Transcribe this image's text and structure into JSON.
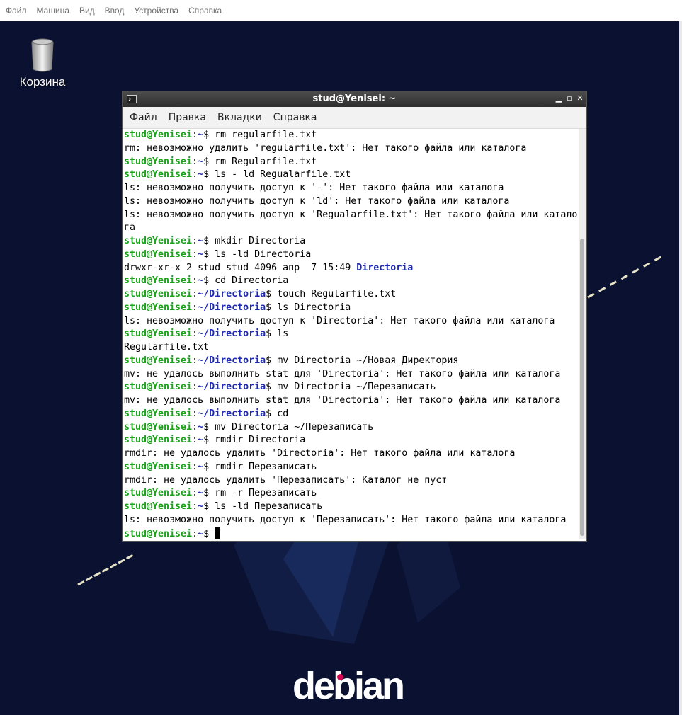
{
  "vm_menu": [
    "Файл",
    "Машина",
    "Вид",
    "Ввод",
    "Устройства",
    "Справка"
  ],
  "desktop": {
    "trash_label": "Корзина",
    "logo_text": "debian",
    "colors": {
      "background": "#0a1131",
      "logo_dot": "#d70751"
    }
  },
  "terminal": {
    "title": "stud@Yenisei: ~",
    "menu": [
      "Файл",
      "Правка",
      "Вкладки",
      "Справка"
    ],
    "colors": {
      "user": "#1aa31a",
      "path": "#1e2ab4"
    },
    "lines": [
      {
        "type": "cmd",
        "user": "stud@Yenisei",
        "path": "~",
        "cmd": " rm regularfile.txt"
      },
      {
        "type": "out",
        "text": "rm: невозможно удалить 'regularfile.txt': Нет такого файла или каталога"
      },
      {
        "type": "cmd",
        "user": "stud@Yenisei",
        "path": "~",
        "cmd": " rm Regularfile.txt"
      },
      {
        "type": "cmd",
        "user": "stud@Yenisei",
        "path": "~",
        "cmd": " ls - ld Regualarfile.txt"
      },
      {
        "type": "out",
        "text": "ls: невозможно получить доступ к '-': Нет такого файла или каталога"
      },
      {
        "type": "out",
        "text": "ls: невозможно получить доступ к 'ld': Нет такого файла или каталога"
      },
      {
        "type": "out",
        "text": "ls: невозможно получить доступ к 'Regualarfile.txt': Нет такого файла или катало"
      },
      {
        "type": "out",
        "text": "га"
      },
      {
        "type": "cmd",
        "user": "stud@Yenisei",
        "path": "~",
        "cmd": " mkdir Directoria"
      },
      {
        "type": "cmd",
        "user": "stud@Yenisei",
        "path": "~",
        "cmd": " ls -ld Directoria"
      },
      {
        "type": "dir",
        "text": "drwxr-xr-x 2 stud stud 4096 апр  7 15:49 ",
        "dir": "Directoria"
      },
      {
        "type": "cmd",
        "user": "stud@Yenisei",
        "path": "~",
        "cmd": " cd Directoria"
      },
      {
        "type": "cmd",
        "user": "stud@Yenisei",
        "path": "~/Directoria",
        "cmd": " touch Regularfile.txt"
      },
      {
        "type": "cmd",
        "user": "stud@Yenisei",
        "path": "~/Directoria",
        "cmd": " ls Directoria"
      },
      {
        "type": "out",
        "text": "ls: невозможно получить доступ к 'Directoria': Нет такого файла или каталога"
      },
      {
        "type": "cmd",
        "user": "stud@Yenisei",
        "path": "~/Directoria",
        "cmd": " ls"
      },
      {
        "type": "out",
        "text": "Regularfile.txt"
      },
      {
        "type": "cmd",
        "user": "stud@Yenisei",
        "path": "~/Directoria",
        "cmd": " mv Directoria ~/Новая_Директория"
      },
      {
        "type": "out",
        "text": "mv: не удалось выполнить stat для 'Directoria': Нет такого файла или каталога"
      },
      {
        "type": "cmd",
        "user": "stud@Yenisei",
        "path": "~/Directoria",
        "cmd": " mv Directoria ~/Перезаписать"
      },
      {
        "type": "out",
        "text": "mv: не удалось выполнить stat для 'Directoria': Нет такого файла или каталога"
      },
      {
        "type": "cmd",
        "user": "stud@Yenisei",
        "path": "~/Directoria",
        "cmd": " cd"
      },
      {
        "type": "cmd",
        "user": "stud@Yenisei",
        "path": "~",
        "cmd": " mv Directoria ~/Перезаписать"
      },
      {
        "type": "cmd",
        "user": "stud@Yenisei",
        "path": "~",
        "cmd": " rmdir Directoria"
      },
      {
        "type": "out",
        "text": "rmdir: не удалось удалить 'Directoria': Нет такого файла или каталога"
      },
      {
        "type": "cmd",
        "user": "stud@Yenisei",
        "path": "~",
        "cmd": " rmdir Перезаписать"
      },
      {
        "type": "out",
        "text": "rmdir: не удалось удалить 'Перезаписать': Каталог не пуст"
      },
      {
        "type": "cmd",
        "user": "stud@Yenisei",
        "path": "~",
        "cmd": " rm -r Перезаписать"
      },
      {
        "type": "cmd",
        "user": "stud@Yenisei",
        "path": "~",
        "cmd": " ls -ld Перезаписать"
      },
      {
        "type": "out",
        "text": "ls: невозможно получить доступ к 'Перезаписать': Нет такого файла или каталога"
      },
      {
        "type": "prompt",
        "user": "stud@Yenisei",
        "path": "~",
        "cmd": " "
      }
    ]
  }
}
